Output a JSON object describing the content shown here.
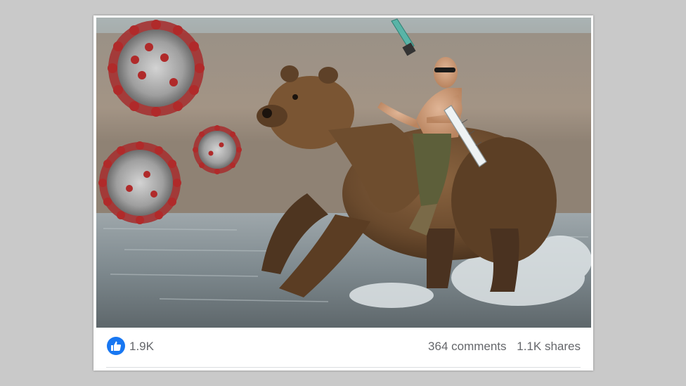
{
  "post": {
    "image_description_icon": "photo-icon",
    "reactions": {
      "like_icon": "thumbs-up-icon",
      "like_count": "1.9K",
      "comments": "364 comments",
      "shares": "1.1K shares"
    }
  },
  "colors": {
    "page_background": "#c9c9c9",
    "card_background": "#ffffff",
    "like_blue": "#1877f2",
    "meta_text": "#65676b"
  }
}
